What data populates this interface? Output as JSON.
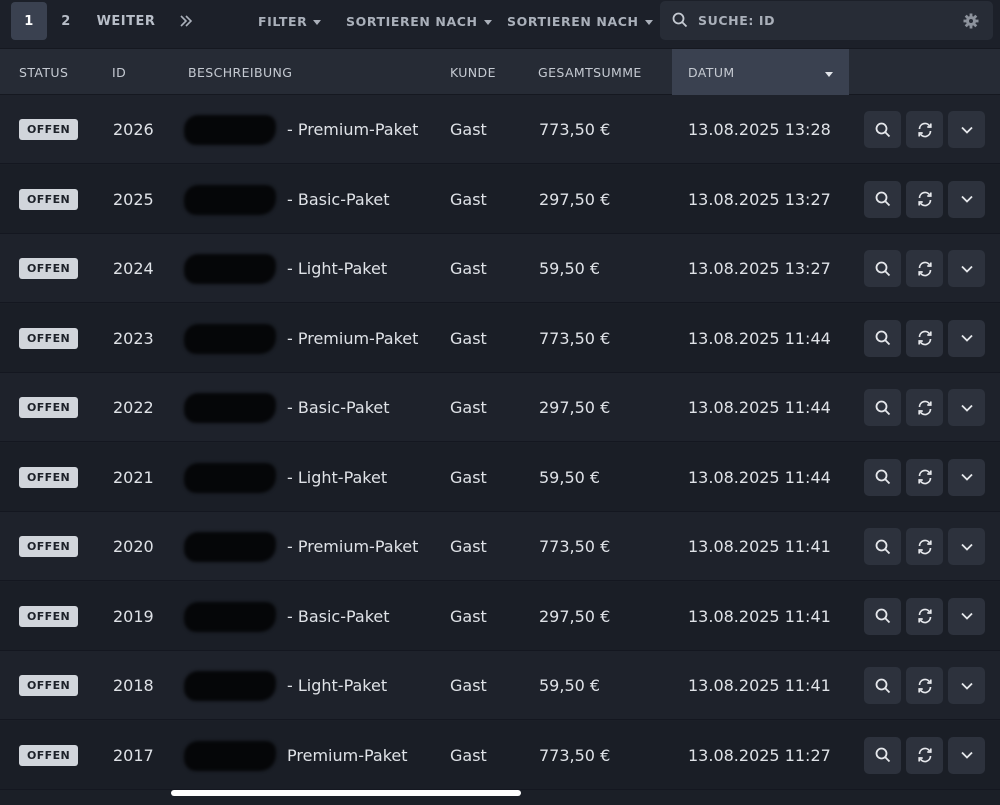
{
  "toolbar": {
    "pages": [
      "1",
      "2"
    ],
    "next_label": "WEITER",
    "last_icon": "double-chevron-right-icon",
    "filter_label": "FILTER",
    "sort1_label": "SORTIEREN NACH",
    "sort2_label": "SORTIEREN NACH",
    "search_placeholder": "SUCHE: ID"
  },
  "table": {
    "headers": {
      "status": "STATUS",
      "id": "ID",
      "description": "BESCHREIBUNG",
      "customer": "KUNDE",
      "total": "GESAMTSUMME",
      "date": "DATUM"
    },
    "sorted_column": "date",
    "rows": [
      {
        "status": "OFFEN",
        "id": "2026",
        "description": "- Premium-Paket",
        "customer": "Gast",
        "total": "773,50 €",
        "date": "13.08.2025 13:28"
      },
      {
        "status": "OFFEN",
        "id": "2025",
        "description": "- Basic-Paket",
        "customer": "Gast",
        "total": "297,50 €",
        "date": "13.08.2025 13:27"
      },
      {
        "status": "OFFEN",
        "id": "2024",
        "description": "- Light-Paket",
        "customer": "Gast",
        "total": "59,50 €",
        "date": "13.08.2025 13:27"
      },
      {
        "status": "OFFEN",
        "id": "2023",
        "description": "- Premium-Paket",
        "customer": "Gast",
        "total": "773,50 €",
        "date": "13.08.2025 11:44"
      },
      {
        "status": "OFFEN",
        "id": "2022",
        "description": "- Basic-Paket",
        "customer": "Gast",
        "total": "297,50 €",
        "date": "13.08.2025 11:44"
      },
      {
        "status": "OFFEN",
        "id": "2021",
        "description": "- Light-Paket",
        "customer": "Gast",
        "total": "59,50 €",
        "date": "13.08.2025 11:44"
      },
      {
        "status": "OFFEN",
        "id": "2020",
        "description": "- Premium-Paket",
        "customer": "Gast",
        "total": "773,50 €",
        "date": "13.08.2025 11:41"
      },
      {
        "status": "OFFEN",
        "id": "2019",
        "description": "- Basic-Paket",
        "customer": "Gast",
        "total": "297,50 €",
        "date": "13.08.2025 11:41"
      },
      {
        "status": "OFFEN",
        "id": "2018",
        "description": "- Light-Paket",
        "customer": "Gast",
        "total": "59,50 €",
        "date": "13.08.2025 11:41"
      },
      {
        "status": "OFFEN",
        "id": "2017",
        "description": "Premium-Paket",
        "customer": "Gast",
        "total": "773,50 €",
        "date": "13.08.2025 11:27"
      }
    ],
    "row_actions": [
      "search-icon",
      "refresh-icon",
      "chevron-down-icon"
    ]
  },
  "colors": {
    "background": "#1b1f27",
    "header": "#262b35",
    "sorted_header": "#3a4150",
    "badge": "#d1d5db",
    "action_button": "#2d323d"
  }
}
